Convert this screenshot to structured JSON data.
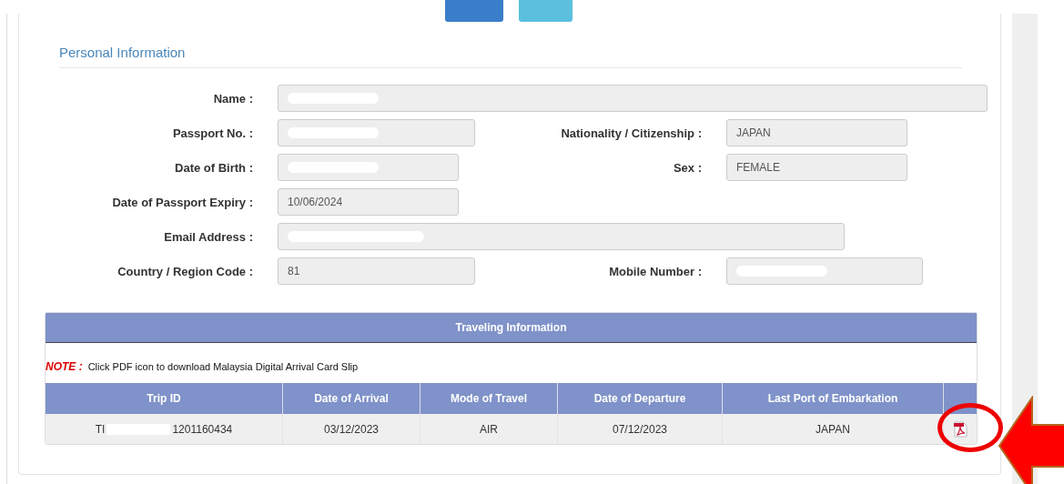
{
  "section_title": "Personal Information",
  "rows": [
    {
      "left": {
        "label": "Name :",
        "redacted": true
      }
    },
    {
      "left": {
        "label": "Passport No. :",
        "redacted": true
      },
      "right": {
        "label": "Nationality / Citizenship :",
        "value": "JAPAN",
        "redacted": false
      }
    },
    {
      "left": {
        "label": "Date of Birth :",
        "redacted": true
      },
      "right": {
        "label": "Sex :",
        "value": "FEMALE",
        "redacted": false
      }
    },
    {
      "left": {
        "label": "Date of Passport Expiry :",
        "value": "10/06/2024",
        "redacted": false
      }
    },
    {
      "left": {
        "label": "Email Address :",
        "redacted": true
      }
    },
    {
      "left": {
        "label": "Country / Region Code :",
        "value": "81",
        "redacted": false
      },
      "right": {
        "label": "Mobile Number :",
        "redacted": true
      }
    }
  ],
  "travel": {
    "title": "Traveling Information",
    "note_label": "NOTE :",
    "note_text": "Click PDF icon to download Malaysia Digital Arrival Card Slip",
    "columns": [
      "Trip ID",
      "Date of Arrival",
      "Mode of Travel",
      "Date of Departure",
      "Last Port of Embarkation"
    ],
    "rows": [
      {
        "cells": [
          {
            "text": "TI",
            "text_end": "1201160434",
            "redacted": true
          },
          {
            "text": "03/12/2023",
            "redacted": false
          },
          {
            "text": "AIR",
            "redacted": false
          },
          {
            "text": "07/12/2023",
            "redacted": false
          },
          {
            "text": "JAPAN",
            "redacted": false
          }
        ],
        "highlighted": true
      }
    ]
  }
}
